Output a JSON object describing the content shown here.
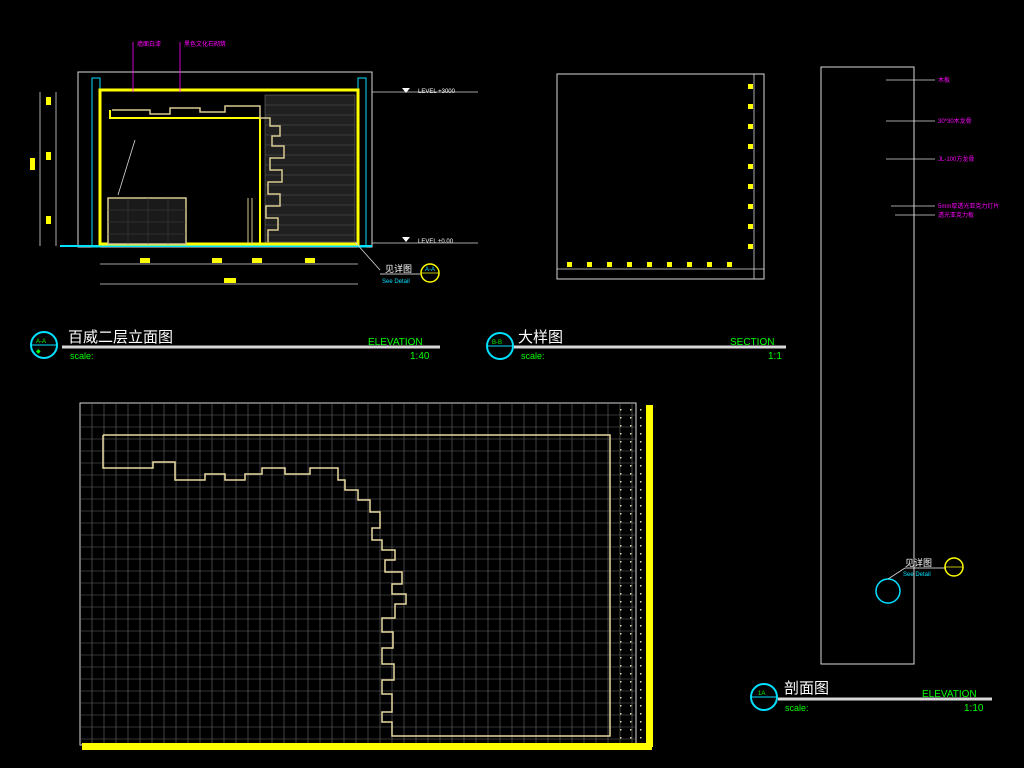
{
  "colors": {
    "background": "#000000",
    "line": "#d8d8d8",
    "accent": "#ffff00",
    "cyan": "#00e0ff",
    "green": "#00ff00",
    "magenta": "#ff00ff"
  },
  "elevation_view": {
    "title": "百威二层立面图",
    "tag": "ELEVATION",
    "scale_label": "scale:",
    "scale_value": "1:40",
    "level_top": "LEVEL +3000",
    "level_bottom": "LEVEL ±0.00",
    "see_detail": "见详图",
    "see_detail_sub": "See Detail",
    "note_1": "墙面白漆",
    "note_2": "黑色文化石砌筑",
    "symbol_top": "A-A",
    "symbol_bottom": "◆",
    "detail_symbol": "A-A"
  },
  "detail_view": {
    "title": "大样图",
    "tag": "SECTION",
    "scale_label": "scale:",
    "scale_value": "1:1",
    "symbol_top": "B-B",
    "symbol_bottom": ""
  },
  "section_view": {
    "title": "剖面图",
    "tag": "ELEVATION",
    "scale_label": "scale:",
    "scale_value": "1:10",
    "notes": [
      "木板",
      "30*30木龙骨",
      "JL-100方龙骨",
      "5mm厚透光亚克力灯片",
      "透光亚克力板"
    ],
    "see_detail": "见详图",
    "see_detail_sub": "See Detail",
    "symbol": "1A"
  }
}
